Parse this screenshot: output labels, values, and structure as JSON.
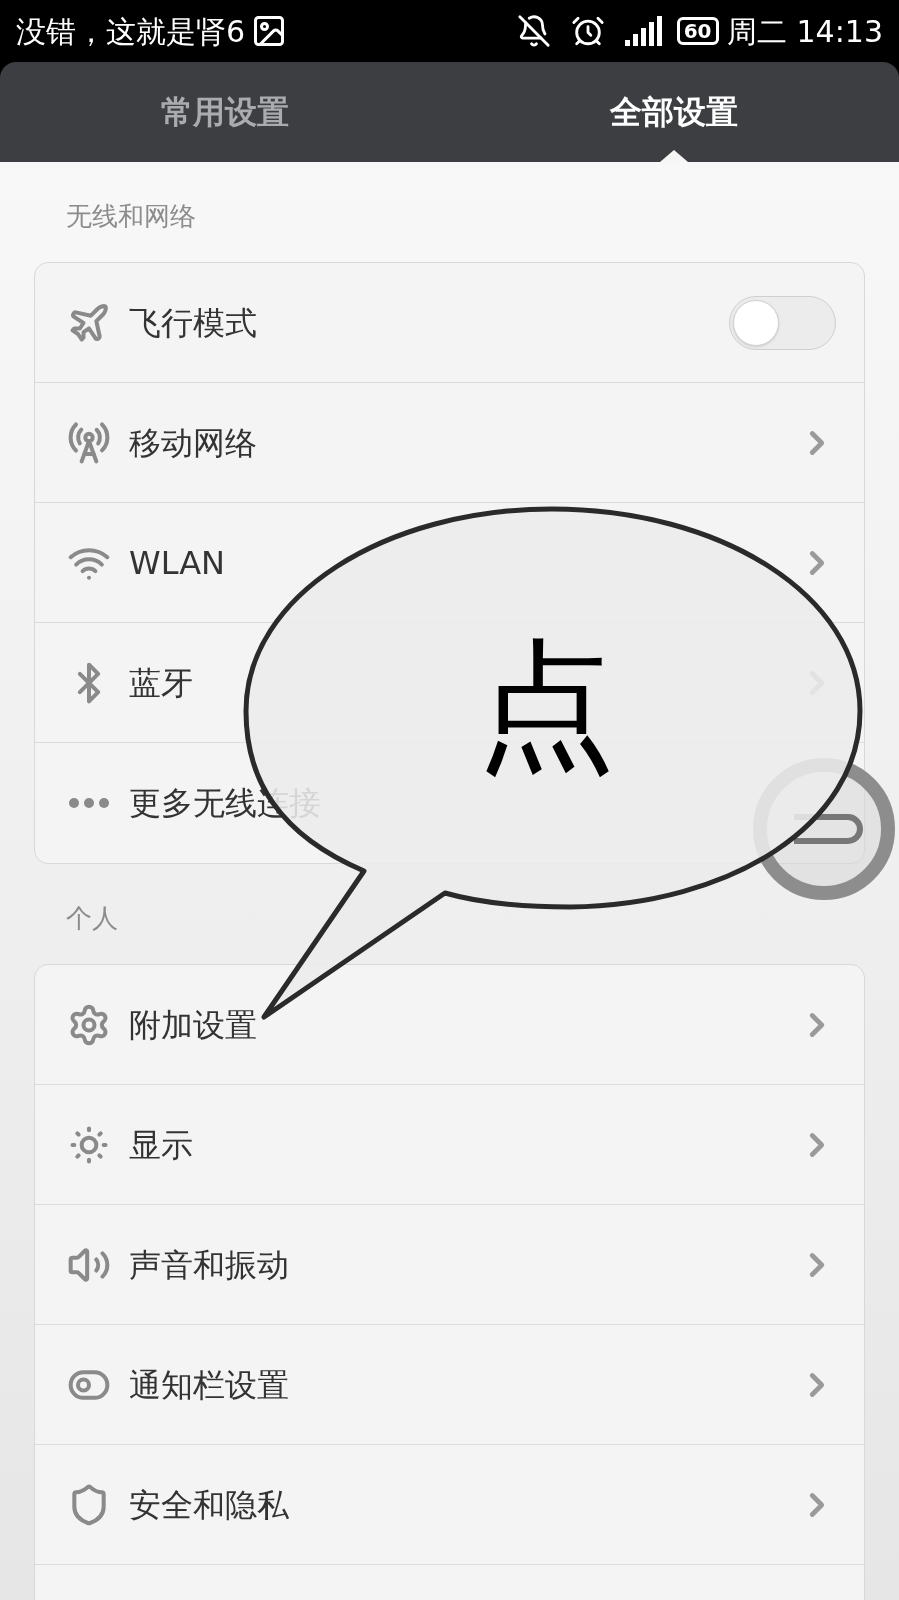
{
  "status_bar": {
    "notification": "没错，这就是肾6",
    "battery": "60",
    "day": "周二",
    "time": "14:13"
  },
  "tabs": [
    {
      "label": "常用设置",
      "selected": false
    },
    {
      "label": "全部设置",
      "selected": true
    }
  ],
  "sections": [
    {
      "title": "无线和网络",
      "items": [
        {
          "kind": "toggle",
          "label": "飞行模式",
          "on": false
        },
        {
          "kind": "link",
          "label": "移动网络"
        },
        {
          "kind": "link",
          "label": "WLAN"
        },
        {
          "kind": "link",
          "label": "蓝牙"
        },
        {
          "kind": "plain",
          "label": "更多无线连接"
        }
      ]
    },
    {
      "title": "个人",
      "items": [
        {
          "kind": "link",
          "label": "附加设置"
        },
        {
          "kind": "link",
          "label": "显示"
        },
        {
          "kind": "link",
          "label": "声音和振动"
        },
        {
          "kind": "link",
          "label": "通知栏设置"
        },
        {
          "kind": "link",
          "label": "安全和隐私"
        }
      ]
    }
  ],
  "callout": {
    "text": "点"
  }
}
